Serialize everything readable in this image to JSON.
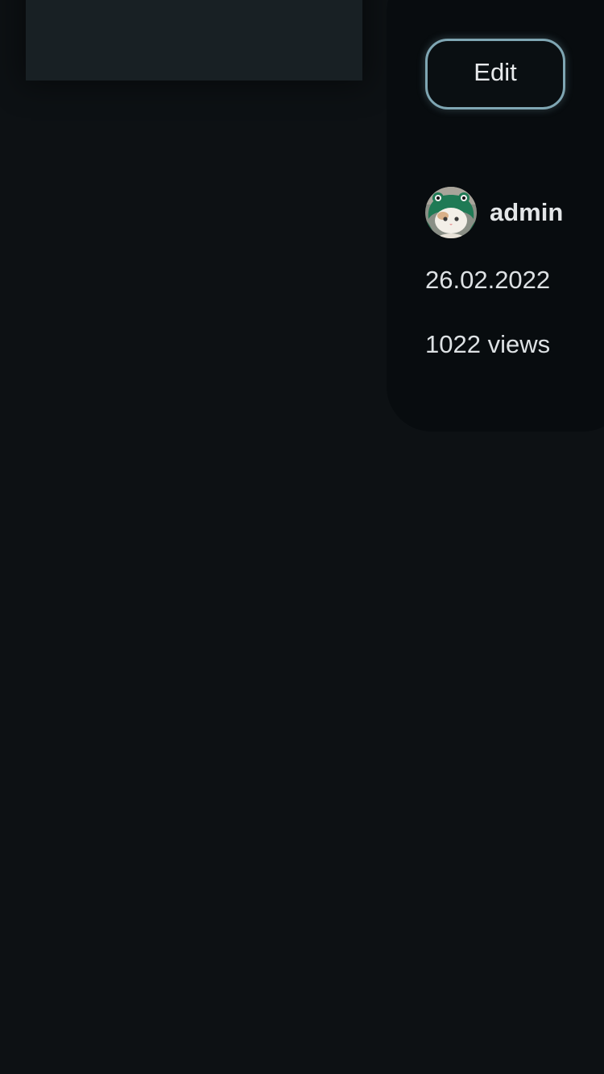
{
  "post": {
    "edit_label": "Edit",
    "author": "admin",
    "avatar_icon": "cat-in-frog-hat-avatar",
    "date": "26.02.2022",
    "views": "1022 views"
  },
  "colors": {
    "background": "#0d1114",
    "panel": "#080c0f",
    "button_border": "#7fa6b3",
    "text": "#e3e6e8"
  }
}
